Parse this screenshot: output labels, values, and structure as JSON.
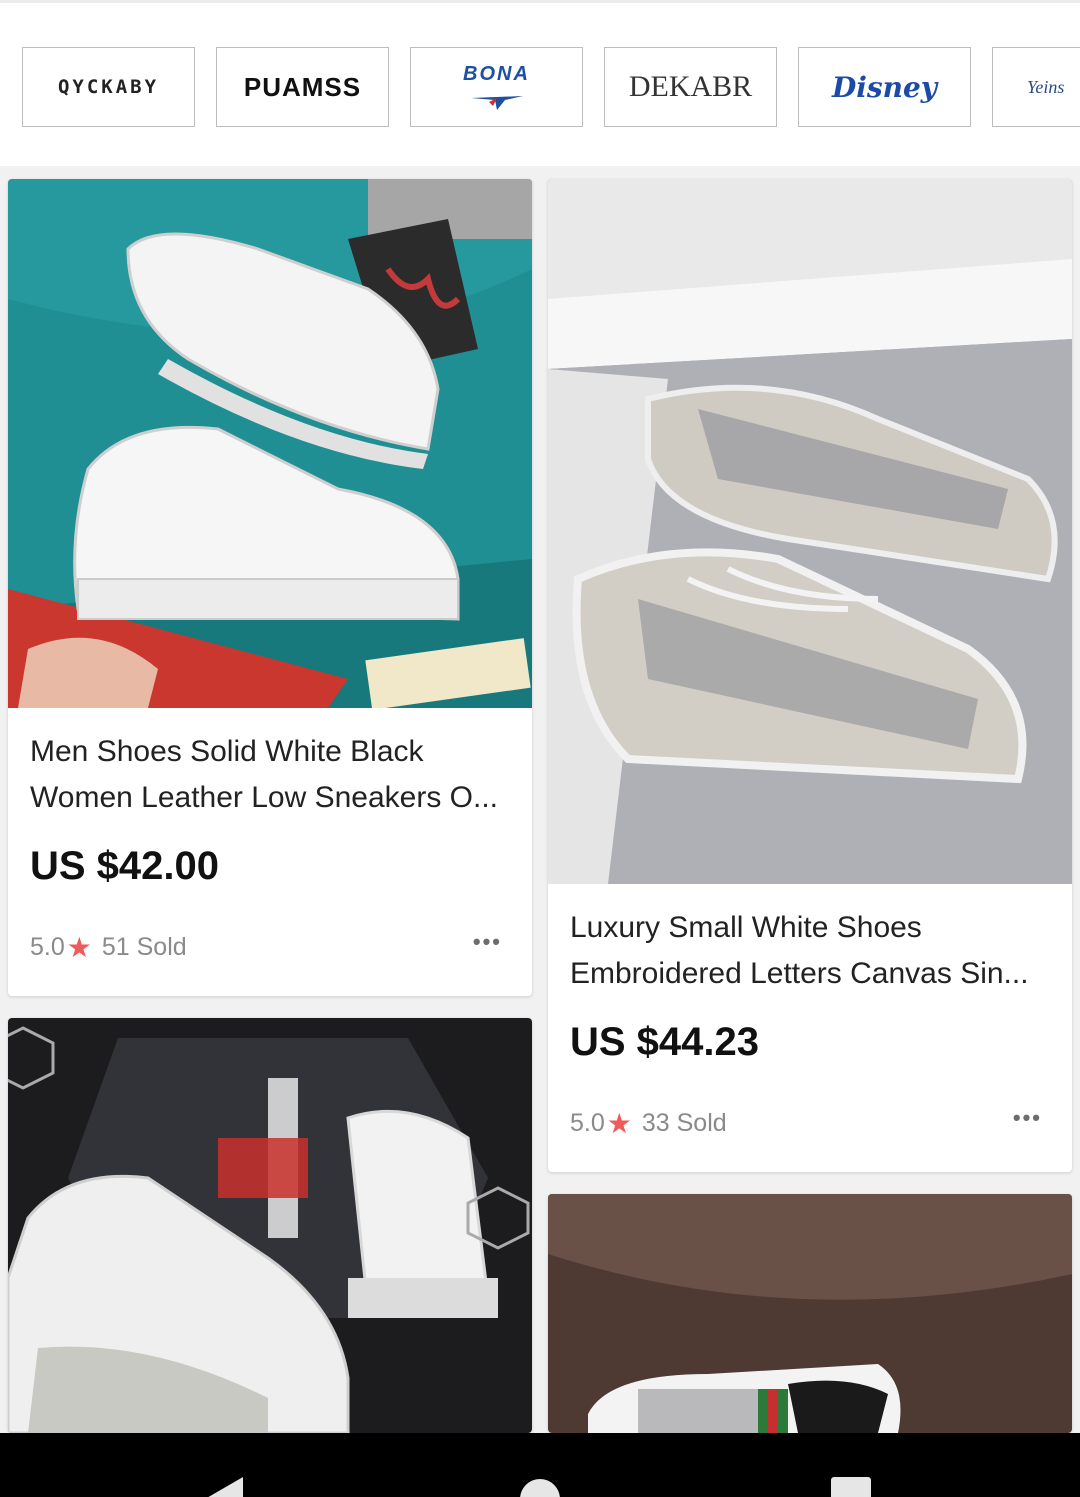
{
  "brands": [
    {
      "label": "QYCKABY"
    },
    {
      "label": "PUAMSS"
    },
    {
      "label": "BONA"
    },
    {
      "label": "DEKABR"
    },
    {
      "label": "Disney"
    },
    {
      "label": "Yeins"
    }
  ],
  "products": [
    {
      "title": "Men Shoes Solid White Black Women Leather Low Sneakers O...",
      "price": "US $42.00",
      "rating": "5.0",
      "sold": "51 Sold"
    },
    {
      "title": "Luxury Small White Shoes Embroidered Letters Canvas Sin...",
      "price": "US $44.23",
      "rating": "5.0",
      "sold": "33 Sold"
    }
  ],
  "colors": {
    "accent_star": "#ef5a5a",
    "background": "#f1f1f1"
  }
}
